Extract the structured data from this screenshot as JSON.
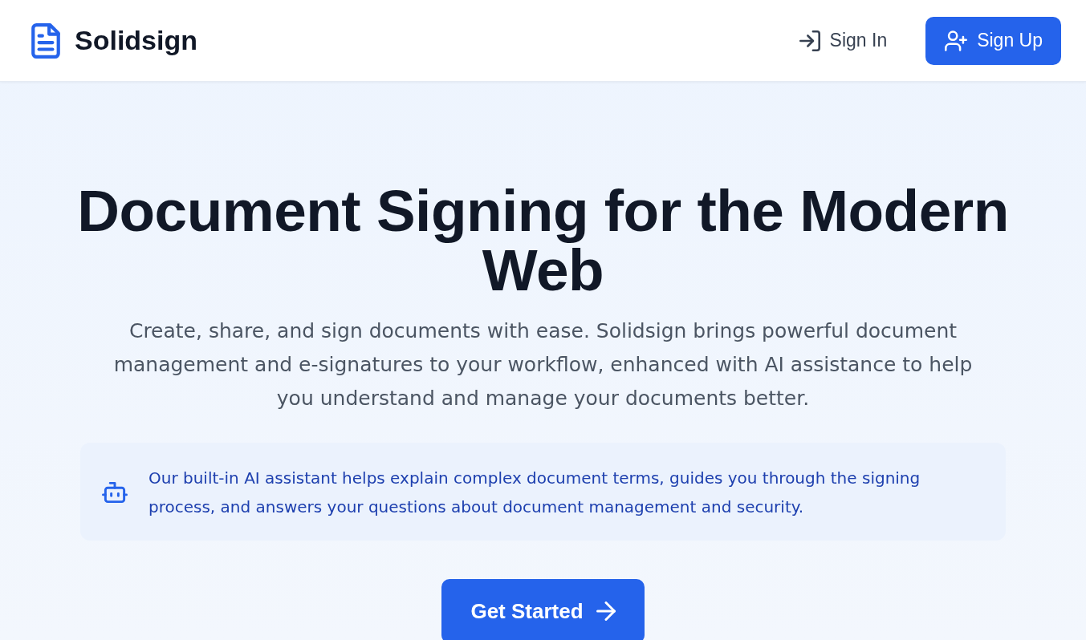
{
  "header": {
    "brand": "Solidsign",
    "actions": [
      {
        "kind": "link",
        "label": "Sign In"
      },
      {
        "kind": "primary",
        "label": "Sign Up"
      }
    ]
  },
  "hero": {
    "title": "Document Signing for the Modern Web",
    "subtitle": "Create, share, and sign documents with ease. Solidsign brings powerful document management and e-signatures to your workflow, enhanced with AI assistance to help you understand and manage your documents better.",
    "notice": {
      "text": "Our built-in AI assistant helps explain complex document terms, guides you through the signing process, and answers your questions about document management and security."
    },
    "cta": {
      "label": "Get Started"
    }
  }
}
